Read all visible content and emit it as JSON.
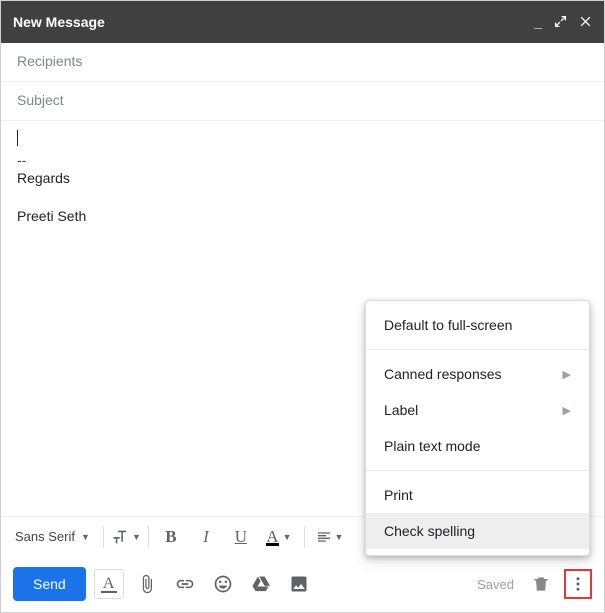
{
  "titlebar": {
    "title": "New Message"
  },
  "fields": {
    "recipients_placeholder": "Recipients",
    "subject_placeholder": "Subject"
  },
  "body": {
    "separator": "--",
    "regards": "Regards",
    "name": "Preeti Seth"
  },
  "format": {
    "font_family": "Sans Serif"
  },
  "sendbar": {
    "send": "Send",
    "saved": "Saved"
  },
  "menu": {
    "fullscreen": "Default to full-screen",
    "canned": "Canned responses",
    "label": "Label",
    "plaintext": "Plain text mode",
    "print": "Print",
    "spelling": "Check spelling"
  }
}
